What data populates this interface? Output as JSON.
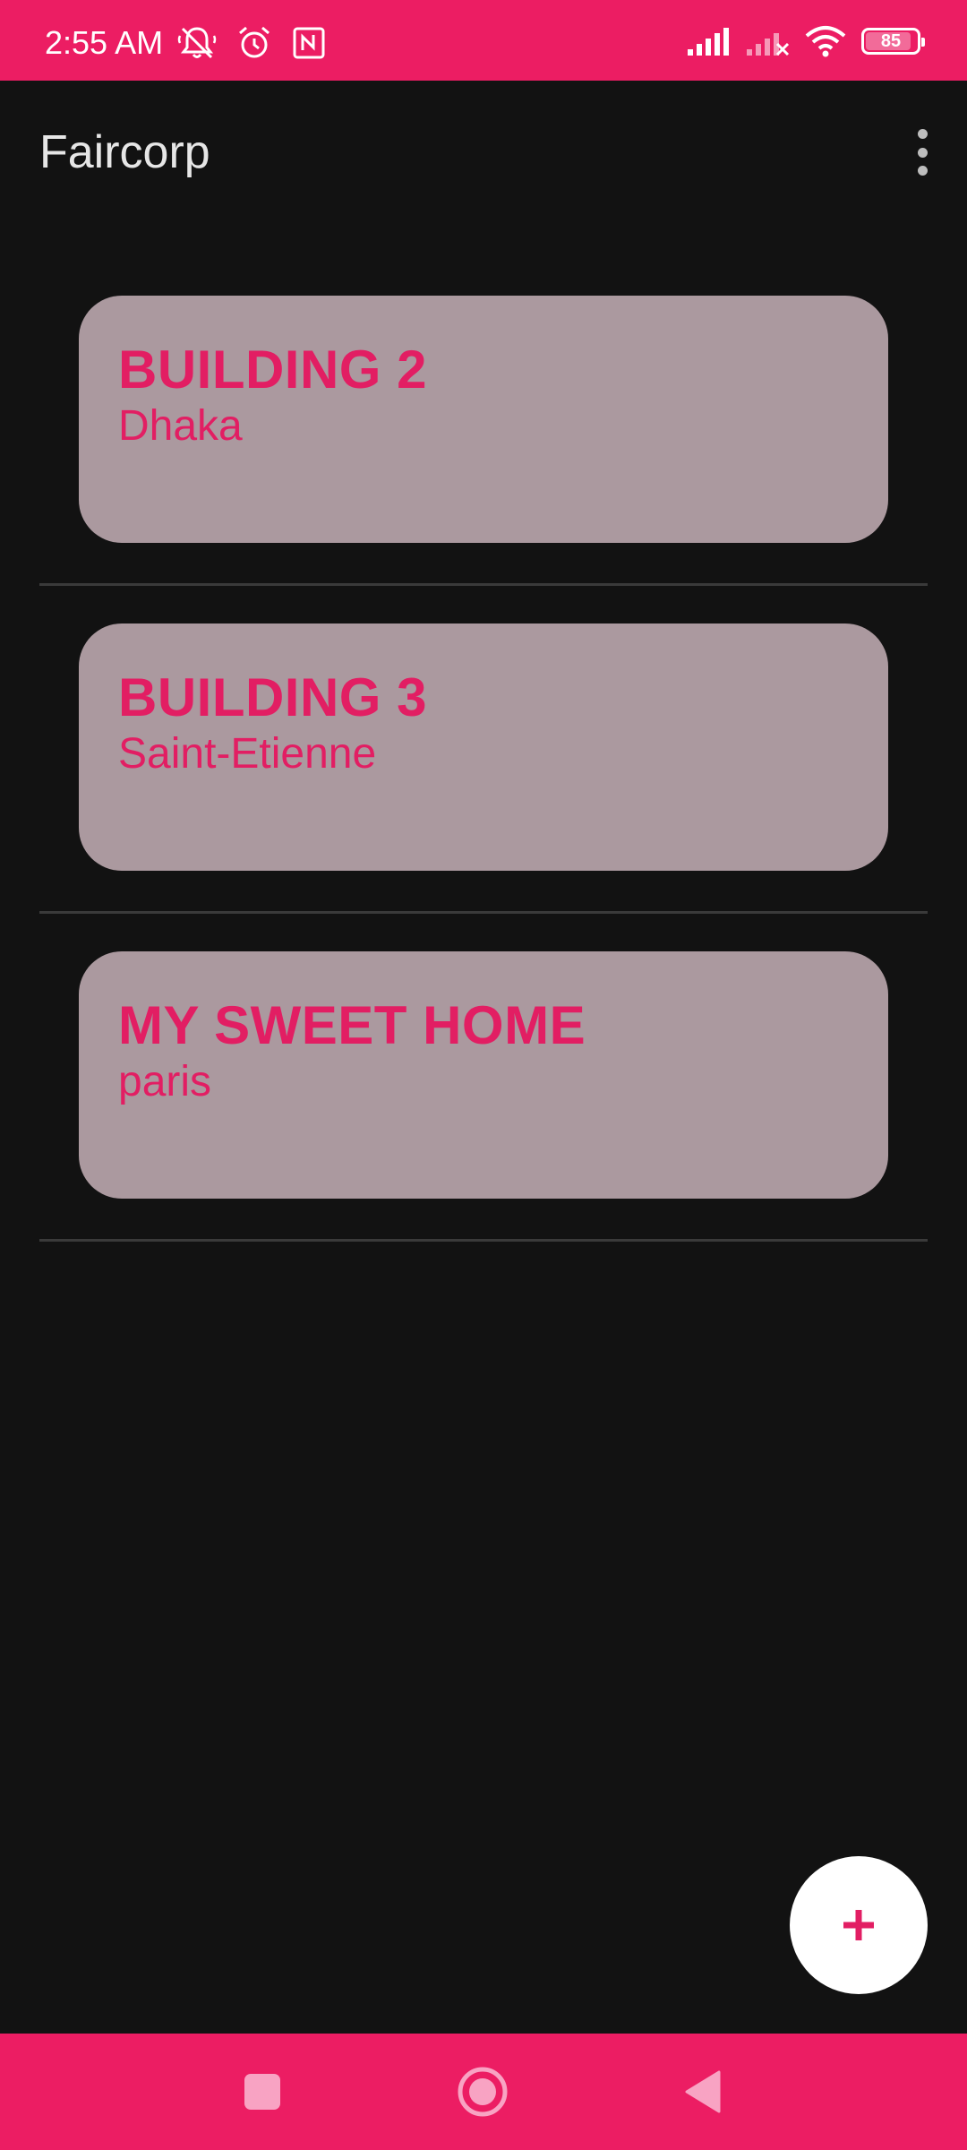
{
  "status_bar": {
    "time": "2:55 AM",
    "battery_level": "85",
    "icons": [
      "notifications-off-icon",
      "alarm-icon",
      "nfc-icon",
      "signal-icon",
      "signal-no-service-icon",
      "wifi-icon",
      "battery-icon"
    ]
  },
  "app_bar": {
    "title": "Faircorp",
    "menu_icon": "more-vert-icon"
  },
  "buildings": [
    {
      "name": "BUILDING 2",
      "city": "Dhaka"
    },
    {
      "name": "BUILDING 3",
      "city": "Saint-Etienne"
    },
    {
      "name": "MY SWEET HOME",
      "city": "paris"
    }
  ],
  "fab": {
    "icon": "add-icon"
  },
  "nav_bar": {
    "icons": [
      "recents-square-icon",
      "home-circle-icon",
      "back-triangle-icon"
    ]
  },
  "colors": {
    "accent": "#EC1D63",
    "card_background": "#AB999F",
    "card_text": "#E21E63",
    "background": "#121212"
  }
}
